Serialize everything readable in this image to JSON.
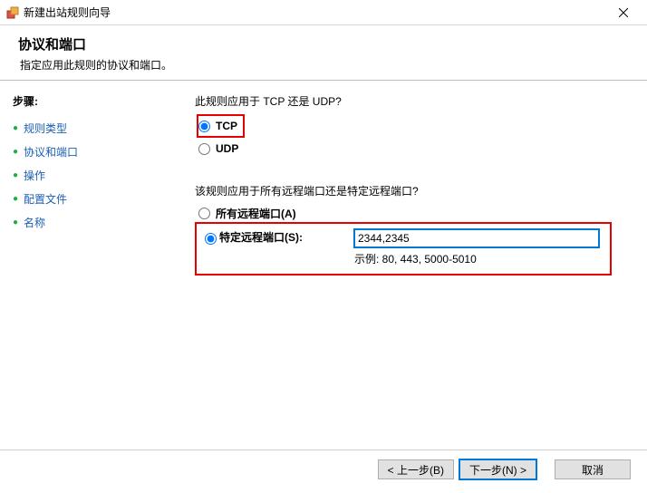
{
  "window": {
    "title": "新建出站规则向导"
  },
  "header": {
    "title": "协议和端口",
    "subtitle": "指定应用此规则的协议和端口。"
  },
  "sidebar": {
    "steps_label": "步骤:",
    "items": [
      {
        "label": "规则类型"
      },
      {
        "label": "协议和端口"
      },
      {
        "label": "操作"
      },
      {
        "label": "配置文件"
      },
      {
        "label": "名称"
      }
    ]
  },
  "content": {
    "protocol_question": "此规则应用于 TCP 还是 UDP?",
    "tcp_label": "TCP",
    "udp_label": "UDP",
    "port_question": "该规则应用于所有远程端口还是特定远程端口?",
    "all_ports_label": "所有远程端口(A)",
    "specific_ports_label": "特定远程端口(S):",
    "ports_value": "2344,2345",
    "example_label": "示例: 80, 443, 5000-5010"
  },
  "footer": {
    "back": "< 上一步(B)",
    "next": "下一步(N) >",
    "cancel": "取消"
  }
}
